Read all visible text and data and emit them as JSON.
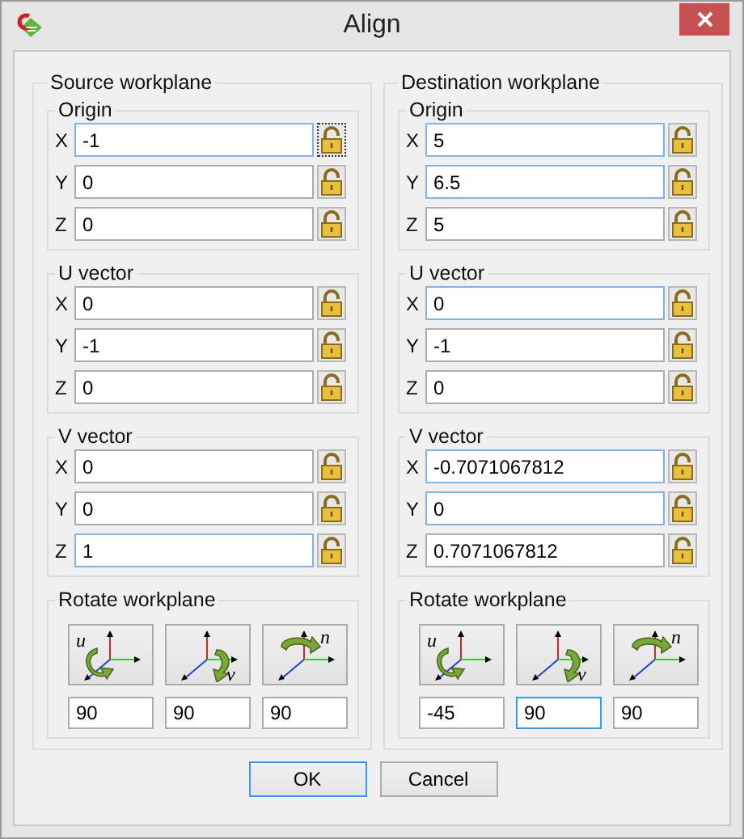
{
  "window": {
    "title": "Align"
  },
  "panels": [
    {
      "title": "Source workplane",
      "groups": [
        {
          "title": "Origin",
          "fields": [
            {
              "axis": "X",
              "value": "-1",
              "highlighted": true,
              "lock_focused": true
            },
            {
              "axis": "Y",
              "value": "0",
              "highlighted": false,
              "lock_focused": false
            },
            {
              "axis": "Z",
              "value": "0",
              "highlighted": false,
              "lock_focused": false
            }
          ]
        },
        {
          "title": "U vector",
          "fields": [
            {
              "axis": "X",
              "value": "0",
              "highlighted": false,
              "lock_focused": false
            },
            {
              "axis": "Y",
              "value": "-1",
              "highlighted": false,
              "lock_focused": false
            },
            {
              "axis": "Z",
              "value": "0",
              "highlighted": false,
              "lock_focused": false
            }
          ]
        },
        {
          "title": "V vector",
          "fields": [
            {
              "axis": "X",
              "value": "0",
              "highlighted": false,
              "lock_focused": false
            },
            {
              "axis": "Y",
              "value": "0",
              "highlighted": false,
              "lock_focused": false
            },
            {
              "axis": "Z",
              "value": "1",
              "highlighted": true,
              "lock_focused": false
            }
          ]
        }
      ],
      "rotate": {
        "title": "Rotate workplane",
        "buttons": [
          {
            "kind": "u",
            "letter": "u"
          },
          {
            "kind": "v",
            "letter": "v"
          },
          {
            "kind": "n",
            "letter": "n"
          }
        ],
        "angles": [
          {
            "value": "90",
            "highlighted": false
          },
          {
            "value": "90",
            "highlighted": false
          },
          {
            "value": "90",
            "highlighted": false
          }
        ]
      }
    },
    {
      "title": "Destination workplane",
      "groups": [
        {
          "title": "Origin",
          "fields": [
            {
              "axis": "X",
              "value": "5",
              "highlighted": true,
              "lock_focused": false
            },
            {
              "axis": "Y",
              "value": "6.5",
              "highlighted": true,
              "lock_focused": false
            },
            {
              "axis": "Z",
              "value": "5",
              "highlighted": false,
              "lock_focused": false
            }
          ]
        },
        {
          "title": "U vector",
          "fields": [
            {
              "axis": "X",
              "value": "0",
              "highlighted": true,
              "lock_focused": false
            },
            {
              "axis": "Y",
              "value": "-1",
              "highlighted": false,
              "lock_focused": false
            },
            {
              "axis": "Z",
              "value": "0",
              "highlighted": false,
              "lock_focused": false
            }
          ]
        },
        {
          "title": "V vector",
          "fields": [
            {
              "axis": "X",
              "value": "-0.7071067812",
              "highlighted": true,
              "lock_focused": false
            },
            {
              "axis": "Y",
              "value": "0",
              "highlighted": true,
              "lock_focused": false
            },
            {
              "axis": "Z",
              "value": "0.7071067812",
              "highlighted": false,
              "lock_focused": false
            }
          ]
        }
      ],
      "rotate": {
        "title": "Rotate workplane",
        "buttons": [
          {
            "kind": "u",
            "letter": "u"
          },
          {
            "kind": "v",
            "letter": "v"
          },
          {
            "kind": "n",
            "letter": "n"
          }
        ],
        "angles": [
          {
            "value": "-45",
            "highlighted": false
          },
          {
            "value": "90",
            "highlighted": true
          },
          {
            "value": "90",
            "highlighted": false
          }
        ]
      }
    }
  ],
  "buttons": [
    {
      "label": "OK",
      "default": true
    },
    {
      "label": "Cancel",
      "default": false
    }
  ]
}
